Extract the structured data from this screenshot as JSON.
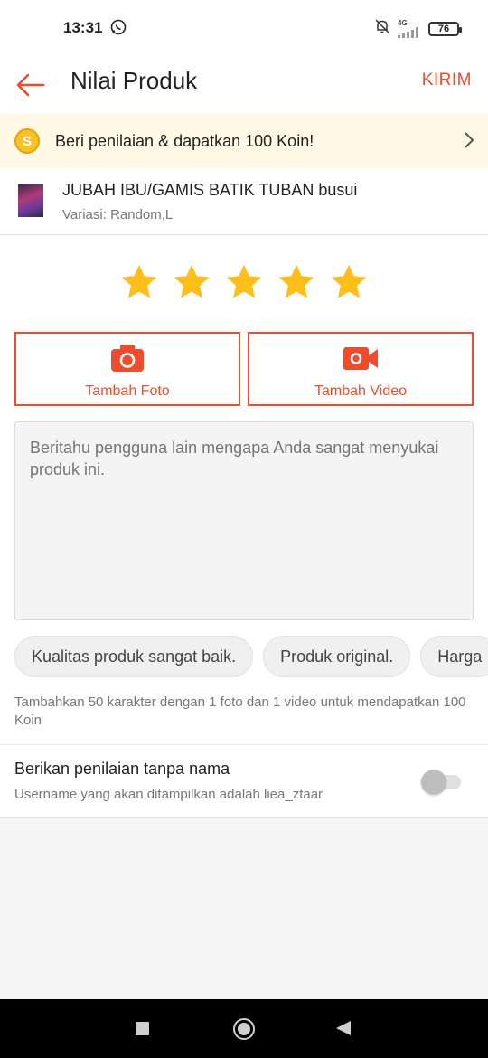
{
  "status_bar": {
    "time": "13:31",
    "network": "4G",
    "battery": "76",
    "icons": [
      "whatsapp-icon",
      "mute-bell-icon",
      "signal-icon",
      "battery-icon"
    ]
  },
  "header": {
    "title": "Nilai Produk",
    "send_label": "KIRIM",
    "back_icon": "back-arrow-icon"
  },
  "coin_banner": {
    "coin_symbol": "S",
    "text": "Beri penilaian & dapatkan 100 Koin!"
  },
  "product": {
    "name": "JUBAH IBU/GAMIS BATIK TUBAN busui",
    "variant": "Variasi: Random,L"
  },
  "rating": {
    "value": 5,
    "max": 5
  },
  "media": {
    "photo_label": "Tambah Foto",
    "video_label": "Tambah Video"
  },
  "comment": {
    "placeholder": "Beritahu pengguna lain mengapa Anda sangat menyukai produk ini."
  },
  "chips": [
    "Kualitas produk sangat baik.",
    "Produk original.",
    "Harga"
  ],
  "hint": "Tambahkan 50 karakter dengan 1 foto dan 1 video untuk mendapatkan 100 Koin",
  "anonymous": {
    "title": "Berikan penilaian tanpa nama",
    "subtitle": "Username yang akan ditampilkan adalah liea_ztaar",
    "enabled": false
  },
  "colors": {
    "accent": "#ee4d2d",
    "star": "#ffbf1a",
    "banner_bg": "#fff9e6"
  }
}
